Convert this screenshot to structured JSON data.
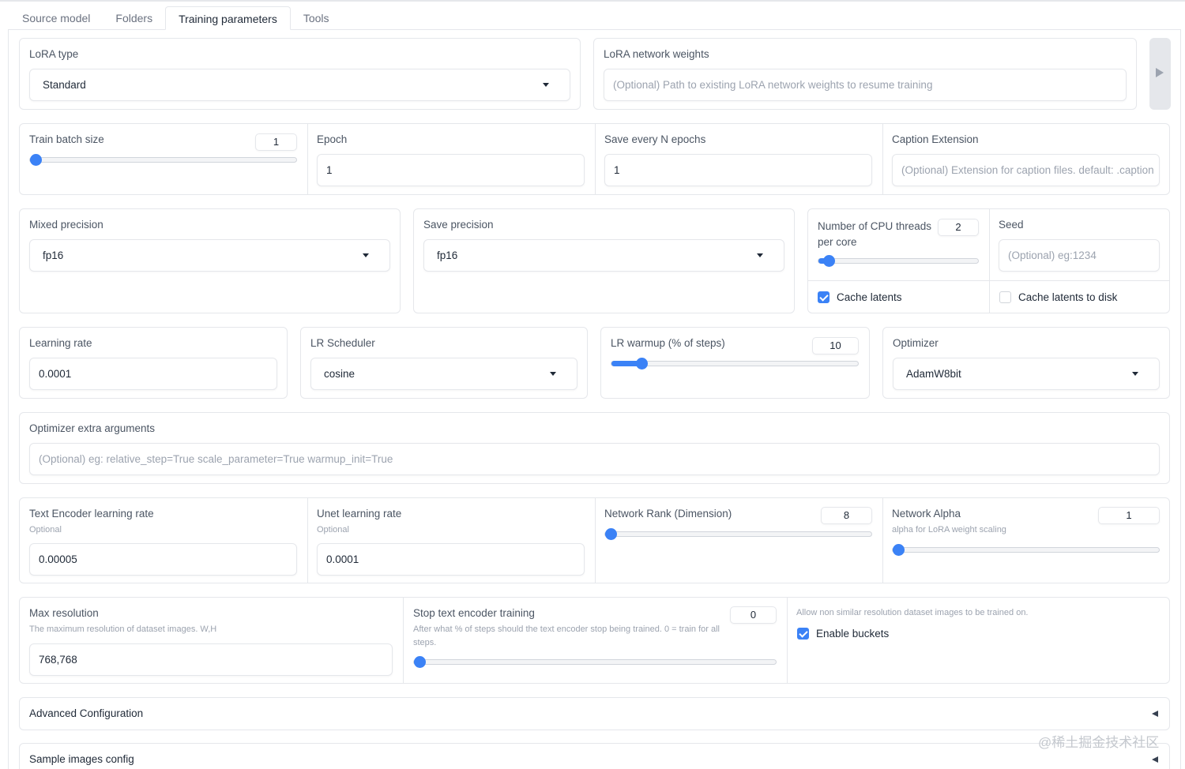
{
  "tabs": [
    "Source model",
    "Folders",
    "Training parameters",
    "Tools"
  ],
  "active_tab": 2,
  "lora_type": {
    "label": "LoRA type",
    "value": "Standard"
  },
  "lora_weights": {
    "label": "LoRA network weights",
    "placeholder": "(Optional) Path to existing LoRA network weights to resume training"
  },
  "train_batch_size": {
    "label": "Train batch size",
    "value": "1",
    "level": 0.0
  },
  "epoch": {
    "label": "Epoch",
    "value": "1"
  },
  "save_every": {
    "label": "Save every N epochs",
    "value": "1"
  },
  "caption_ext": {
    "label": "Caption Extension",
    "placeholder": "(Optional) Extension for caption files. default: .caption"
  },
  "mixed_precision": {
    "label": "Mixed precision",
    "value": "fp16"
  },
  "save_precision": {
    "label": "Save precision",
    "value": "fp16"
  },
  "cpu_threads": {
    "label_line1": "Number of CPU threads",
    "label_line2": "per core",
    "value": "2",
    "level": 0.03
  },
  "seed": {
    "label": "Seed",
    "placeholder": "(Optional) eg:1234"
  },
  "cache_latents": {
    "label": "Cache latents",
    "checked": true
  },
  "cache_latents_disk": {
    "label": "Cache latents to disk",
    "checked": false
  },
  "learning_rate": {
    "label": "Learning rate",
    "value": "0.0001"
  },
  "lr_scheduler": {
    "label": "LR Scheduler",
    "value": "cosine"
  },
  "lr_warmup": {
    "label": "LR warmup (% of steps)",
    "value": "10",
    "level": 0.1
  },
  "optimizer": {
    "label": "Optimizer",
    "value": "AdamW8bit"
  },
  "optimizer_args": {
    "label": "Optimizer extra arguments",
    "placeholder": "(Optional) eg: relative_step=True scale_parameter=True warmup_init=True"
  },
  "text_encoder_lr": {
    "label": "Text Encoder learning rate",
    "sublabel": "Optional",
    "value": "0.00005"
  },
  "unet_lr": {
    "label": "Unet learning rate",
    "sublabel": "Optional",
    "value": "0.0001"
  },
  "network_rank": {
    "label": "Network Rank (Dimension)",
    "value": "8",
    "level": 0.0
  },
  "network_alpha": {
    "label": "Network Alpha",
    "sublabel": "alpha for LoRA weight scaling",
    "value": "1",
    "level": 0.0
  },
  "max_resolution": {
    "label": "Max resolution",
    "sublabel": "The maximum resolution of dataset images. W,H",
    "value": "768,768"
  },
  "stop_te": {
    "label": "Stop text encoder training",
    "sublabel": "After what % of steps should the text encoder stop being trained. 0 = train for all steps.",
    "value": "0",
    "level": 0.0
  },
  "buckets": {
    "hint": "Allow non similar resolution dataset images to be trained on.",
    "label": "Enable buckets",
    "checked": true
  },
  "accordions": {
    "advanced": "Advanced Configuration",
    "sample": "Sample images config"
  },
  "watermark": "@稀土掘金技术社区",
  "colors": {
    "accent": "#3b82f6",
    "border": "#e5e7eb",
    "text": "#1f2937",
    "muted": "#9ca3af"
  }
}
